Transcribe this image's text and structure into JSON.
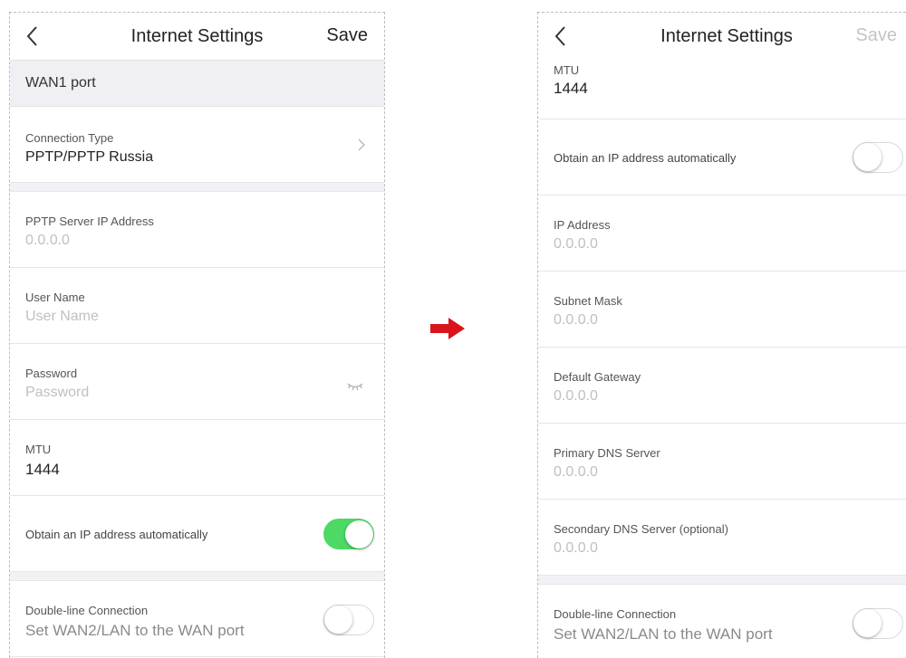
{
  "left": {
    "nav": {
      "title": "Internet Settings",
      "save_label": "Save"
    },
    "section_header": "WAN1 port",
    "connection_type": {
      "label": "Connection Type",
      "value": "PPTP/PPTP Russia"
    },
    "pptp_server": {
      "label": "PPTP Server IP Address",
      "placeholder": "0.0.0.0"
    },
    "user_name": {
      "label": "User Name",
      "placeholder": "User Name"
    },
    "password": {
      "label": "Password",
      "placeholder": "Password"
    },
    "mtu": {
      "label": "MTU",
      "value": "1444"
    },
    "obtain_ip": {
      "label": "Obtain an IP address automatically",
      "enabled": true
    },
    "double_line": {
      "label": "Double-line Connection",
      "description": "Set WAN2/LAN to the WAN port",
      "enabled": false
    }
  },
  "right": {
    "nav": {
      "title": "Internet Settings",
      "save_label": "Save",
      "save_disabled": true
    },
    "mtu": {
      "label": "MTU",
      "value": "1444"
    },
    "obtain_ip": {
      "label": "Obtain an IP address automatically",
      "enabled": false
    },
    "ip_address": {
      "label": "IP Address",
      "placeholder": "0.0.0.0"
    },
    "subnet_mask": {
      "label": "Subnet Mask",
      "placeholder": "0.0.0.0"
    },
    "default_gateway": {
      "label": "Default Gateway",
      "placeholder": "0.0.0.0"
    },
    "primary_dns": {
      "label": "Primary DNS Server",
      "placeholder": "0.0.0.0"
    },
    "secondary_dns": {
      "label": "Secondary DNS Server (optional)",
      "placeholder": "0.0.0.0"
    },
    "double_line": {
      "label": "Double-line Connection",
      "description": "Set WAN2/LAN to the WAN port",
      "enabled": false
    }
  },
  "colors": {
    "toggle_on": "#4cd964",
    "arrow": "#d9141b",
    "section_bg": "#efeff4"
  },
  "icons": {
    "back": "chevron-left-icon",
    "forward": "chevron-right-icon",
    "password_hidden": "eye-closed-icon",
    "transition": "right-arrow-icon"
  }
}
